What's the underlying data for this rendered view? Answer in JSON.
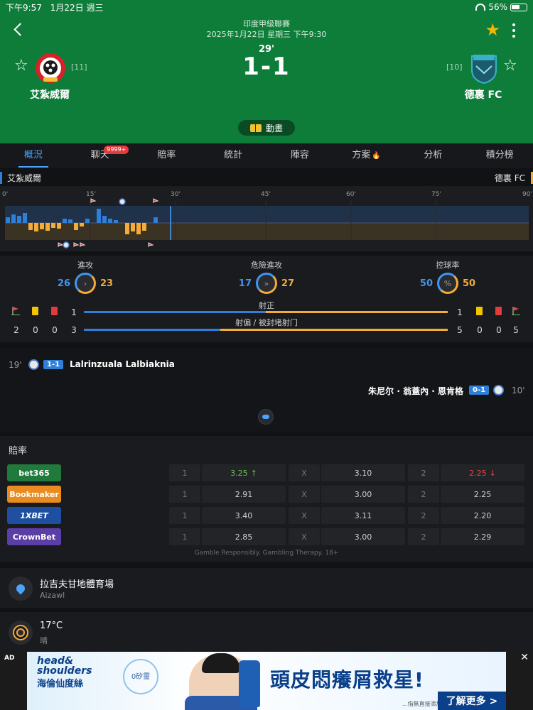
{
  "status_bar": {
    "time": "下午9:57",
    "date": "1月22日 週三",
    "battery": "56%"
  },
  "match": {
    "league": "印度甲級聯賽",
    "datetime": "2025年1月22日 星期三 下午9:30",
    "minute": "29'",
    "score": "1-1",
    "home": {
      "name": "艾紮威爾",
      "rank": "[11]"
    },
    "away": {
      "name": "德裏 FC",
      "rank": "[10]"
    },
    "animation_label": "動畫"
  },
  "tabs": [
    {
      "label": "概況",
      "active": true
    },
    {
      "label": "聊天",
      "badge": "9999+"
    },
    {
      "label": "賠率"
    },
    {
      "label": "統計"
    },
    {
      "label": "陣容"
    },
    {
      "label": "方案",
      "fire": true
    },
    {
      "label": "分析"
    },
    {
      "label": "積分榜"
    }
  ],
  "timeline": {
    "home_label": "艾紮威爾",
    "away_label": "德裏 FC",
    "ticks": [
      "0'",
      "15'",
      "30'",
      "45'",
      "60'",
      "75'",
      "90'"
    ]
  },
  "stats": {
    "attack": {
      "label": "進攻",
      "home": "26",
      "away": "23"
    },
    "dangerous_attack": {
      "label": "危險進攻",
      "home": "17",
      "away": "27"
    },
    "possession": {
      "label": "控球率",
      "home": "50",
      "away": "50"
    },
    "shots_on_target": {
      "label": "射正",
      "home": 1,
      "away": 1
    },
    "shots_off_target": {
      "label": "射偏 / 被封堵射门",
      "home": 3,
      "away": 5
    },
    "home_counts": {
      "corners": "2",
      "yellow": "0",
      "red": "0"
    },
    "away_counts": {
      "yellow": "0",
      "red": "0",
      "corners": "5"
    }
  },
  "events": [
    {
      "minute": "19'",
      "score": "1-1",
      "player": "Lalrinzuala Lalbiaknia",
      "side": "home"
    },
    {
      "minute": "10'",
      "score": "0-1",
      "player": "朱尼尔 · 翁蓋內 · 恩肯格",
      "side": "away"
    }
  ],
  "odds": {
    "title": "賠率",
    "rows": [
      {
        "bookmaker": "bet365",
        "color": "#1f7a3b",
        "h_key": "1",
        "h": "3.25",
        "h_trend": "up",
        "d_key": "X",
        "d": "3.10",
        "a_key": "2",
        "a": "2.25",
        "a_trend": "down"
      },
      {
        "bookmaker": "Bookmaker",
        "color": "#e98b1f",
        "h_key": "1",
        "h": "2.91",
        "d_key": "X",
        "d": "3.00",
        "a_key": "2",
        "a": "2.25"
      },
      {
        "bookmaker": "1XBET",
        "color": "#1f4fa0",
        "h_key": "1",
        "h": "3.40",
        "d_key": "X",
        "d": "3.11",
        "a_key": "2",
        "a": "2.20"
      },
      {
        "bookmaker": "CrownBet",
        "color": "#5b3fa6",
        "h_key": "1",
        "h": "2.85",
        "d_key": "X",
        "d": "3.00",
        "a_key": "2",
        "a": "2.29"
      }
    ],
    "disclaimer": "Gamble Responsibly. Gambling Therapy. 18+"
  },
  "venue": {
    "name": "拉吉夫甘地體育場",
    "city": "Aizawl"
  },
  "weather": {
    "temp": "17°C",
    "condition": "晴"
  },
  "ad": {
    "tag": "AD",
    "brand_line1": "head&",
    "brand_line2": "shoulders",
    "brand_cn": "海倫仙度絲",
    "bubble": "0矽靈",
    "headline": "頭皮悶癢屑救星!",
    "cta": "了解更多 >",
    "small": "...指無直接添加"
  },
  "colors": {
    "home": "#2f7fd9",
    "away": "#f3ab3a",
    "header": "#0f7d3a",
    "accent": "#4aa3ff",
    "star": "#f5b800"
  }
}
